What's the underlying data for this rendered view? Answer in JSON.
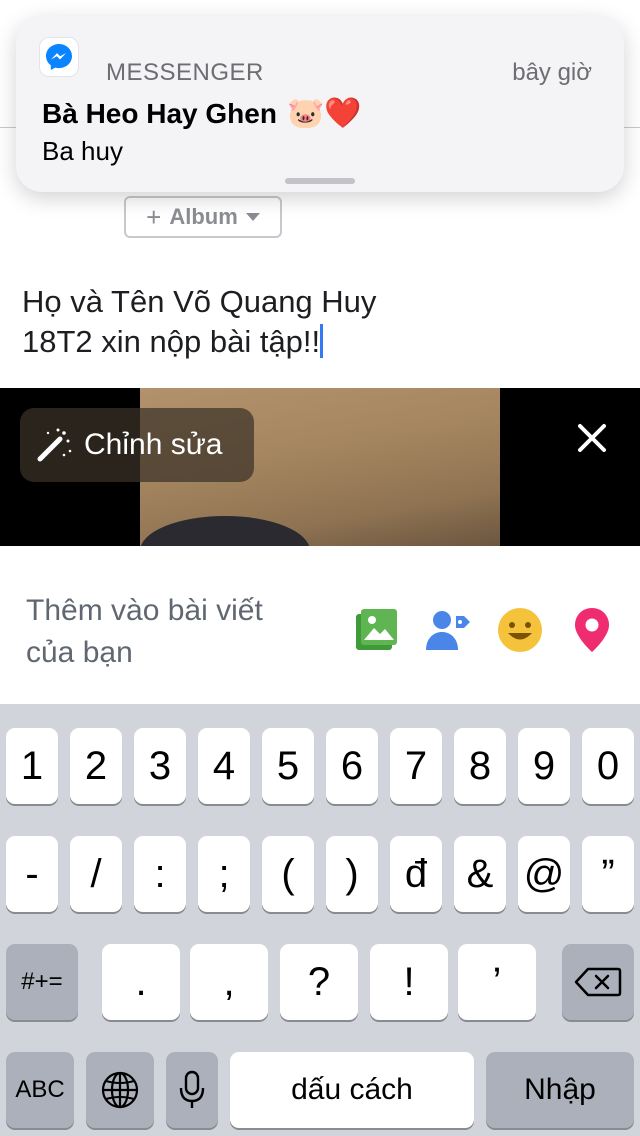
{
  "notification": {
    "app": "MESSENGER",
    "time": "bây giờ",
    "title": "Bà Heo Hay Ghen",
    "title_emoji": "🐷❤️",
    "body": "Ba huy",
    "icon": "messenger-icon"
  },
  "composer": {
    "album_label": "Album",
    "post_line1": "Họ và Tên Võ Quang Huy",
    "post_line2": "18T2 xin nộp bài tập!!"
  },
  "photo": {
    "edit_label": "Chỉnh sửa",
    "edit_icon": "magic-wand-icon",
    "close_icon": "close-icon"
  },
  "add_to_post": {
    "label_line1": "Thêm vào bài viết",
    "label_line2": "của bạn",
    "icons": [
      "photo-icon",
      "tag-people-icon",
      "feeling-icon",
      "location-icon"
    ],
    "colors": {
      "photo": "#5eb552",
      "tag": "#4a86e8",
      "feeling": "#f5c33b",
      "location": "#f02c71"
    }
  },
  "keyboard": {
    "row1": [
      "1",
      "2",
      "3",
      "4",
      "5",
      "6",
      "7",
      "8",
      "9",
      "0"
    ],
    "row2": [
      "-",
      "/",
      ":",
      ";",
      "(",
      ")",
      "đ",
      "&",
      "@",
      "”"
    ],
    "row3_mode": "#+=",
    "row3": [
      ".",
      ",",
      "?",
      "!",
      "’"
    ],
    "abc_label": "ABC",
    "space_label": "dấu cách",
    "return_label": "Nhập"
  }
}
